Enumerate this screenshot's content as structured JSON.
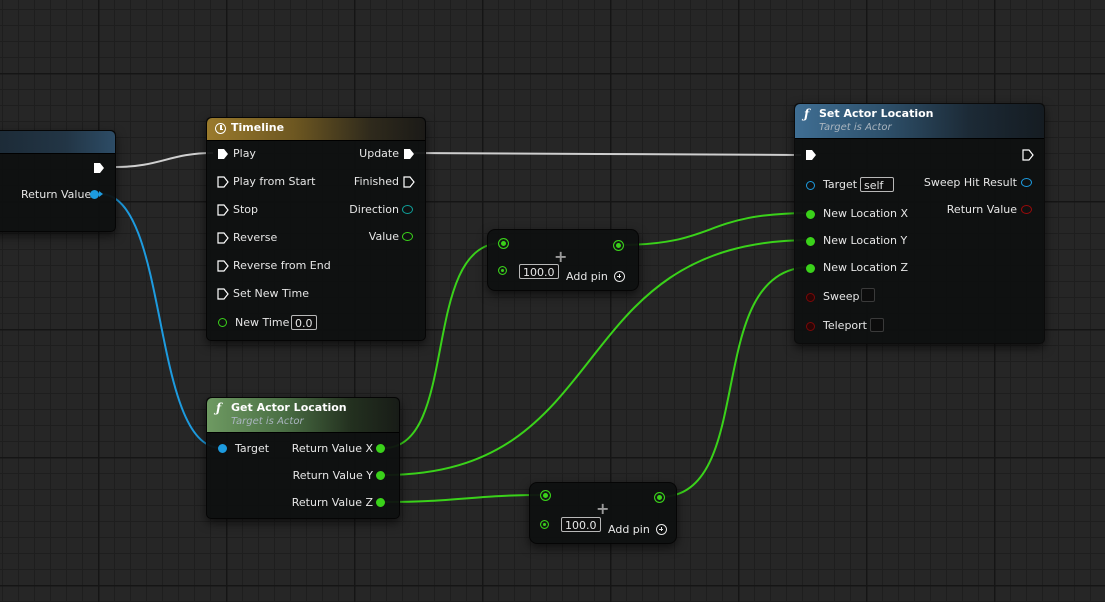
{
  "graph": {
    "partial_node": {
      "return_value_label": "Return Value"
    },
    "timeline": {
      "title": "Timeline",
      "inputs": [
        "Play",
        "Play from Start",
        "Stop",
        "Reverse",
        "Reverse from End",
        "Set New Time"
      ],
      "new_time_label": "New Time",
      "new_time_value": "0.0",
      "outputs": {
        "update": "Update",
        "finished": "Finished",
        "direction": "Direction",
        "value": "Value"
      }
    },
    "set_actor_location": {
      "title": "Set Actor Location",
      "subtitle": "Target is Actor",
      "target_label": "Target",
      "target_value": "self",
      "new_location_x": "New Location X",
      "new_location_y": "New Location Y",
      "new_location_z": "New Location Z",
      "sweep_label": "Sweep",
      "teleport_label": "Teleport",
      "sweep_hit_result": "Sweep Hit Result",
      "return_value": "Return Value"
    },
    "get_actor_location": {
      "title": "Get Actor Location",
      "subtitle": "Target is Actor",
      "target_label": "Target",
      "return_x": "Return Value X",
      "return_y": "Return Value Y",
      "return_z": "Return Value Z"
    },
    "add_node_top": {
      "value": "100.0",
      "add_pin": "Add pin"
    },
    "add_node_bottom": {
      "value": "100.0",
      "add_pin": "Add pin"
    },
    "colors": {
      "exec_wire": "#cfcfcf",
      "float_wire": "#3ad21a",
      "object_wire": "#1d9bdf",
      "background": "#262626"
    }
  }
}
